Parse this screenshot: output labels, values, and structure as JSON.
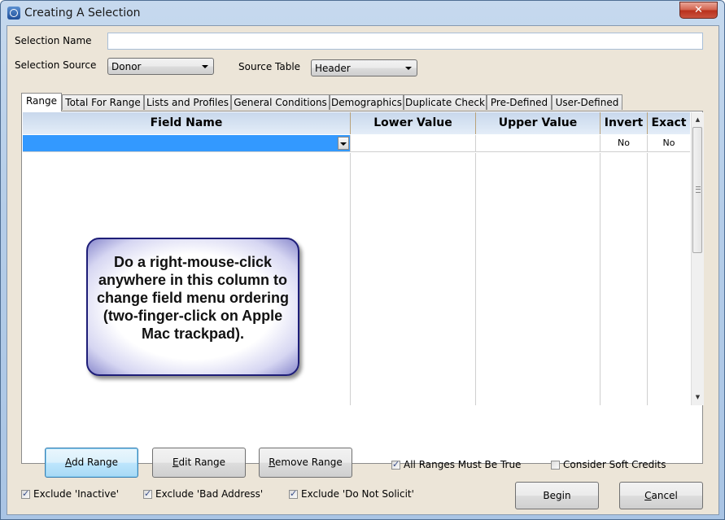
{
  "window": {
    "title": "Creating A Selection",
    "close_icon": "close-x-icon",
    "app_icon": "compass-app-icon"
  },
  "form": {
    "selection_name_label": "Selection Name",
    "selection_name_value": "",
    "selection_source_label": "Selection Source",
    "selection_source_value": "Donor",
    "source_table_label": "Source Table",
    "source_table_value": "Header"
  },
  "tabs": [
    {
      "label": "Range",
      "active": true
    },
    {
      "label": "Total For Range",
      "active": false
    },
    {
      "label": "Lists and Profiles",
      "active": false
    },
    {
      "label": "General Conditions",
      "active": false
    },
    {
      "label": "Demographics",
      "active": false
    },
    {
      "label": "Duplicate Check",
      "active": false
    },
    {
      "label": "Pre-Defined",
      "active": false
    },
    {
      "label": "User-Defined",
      "active": false
    }
  ],
  "grid": {
    "columns": [
      "Field Name",
      "Lower Value",
      "Upper Value",
      "Invert",
      "Exact"
    ],
    "rows": [
      {
        "field_name": "",
        "lower_value": "",
        "upper_value": "",
        "invert": "No",
        "exact": "No",
        "selected": true
      }
    ],
    "selection_color": "#3399ff"
  },
  "callout": {
    "text": "Do a right-mouse-click anywhere in this column to change field menu ordering (two-finger-click on Apple Mac trackpad)."
  },
  "range_buttons": {
    "add": {
      "accel": "A",
      "rest": "dd Range"
    },
    "edit": {
      "accel": "E",
      "rest": "dit Range"
    },
    "remove": {
      "accel": "R",
      "rest": "emove Range"
    }
  },
  "options": {
    "all_ranges_must_be_true": {
      "label": "All Ranges Must Be True",
      "checked": true
    },
    "consider_soft_credits": {
      "label": "Consider Soft Credits",
      "checked": false
    }
  },
  "excludes": [
    {
      "label": "Exclude 'Inactive'",
      "checked": true
    },
    {
      "label": "Exclude 'Bad Address'",
      "checked": true
    },
    {
      "label": "Exclude 'Do Not Solicit'",
      "checked": true
    }
  ],
  "footer_buttons": {
    "begin": "Begin",
    "cancel": {
      "accel": "C",
      "rest": "ancel"
    }
  }
}
